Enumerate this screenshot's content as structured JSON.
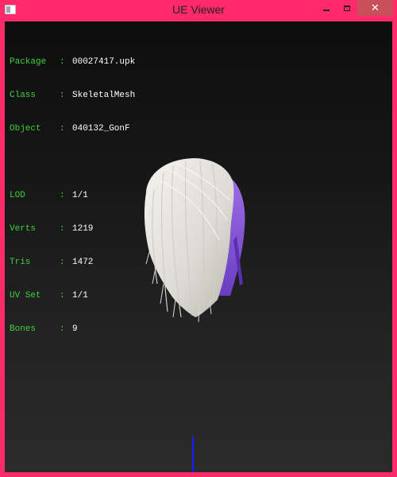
{
  "window": {
    "title": "UE Viewer",
    "minimize_label": "—",
    "close_label": "✕"
  },
  "info": {
    "top": [
      {
        "key": "Package",
        "sep": ":",
        "value": "00027417.upk"
      },
      {
        "key": "Class",
        "sep": ":",
        "value": "SkeletalMesh"
      },
      {
        "key": "Object",
        "sep": ":",
        "value": "040132_GonF"
      }
    ],
    "stats": [
      {
        "key": "LOD",
        "sep": ":",
        "value": "1/1"
      },
      {
        "key": "Verts",
        "sep": ":",
        "value": "1219"
      },
      {
        "key": "Tris",
        "sep": ":",
        "value": "1472"
      },
      {
        "key": "UV Set",
        "sep": ":",
        "value": "1/1"
      },
      {
        "key": "Bones",
        "sep": ":",
        "value": "9"
      }
    ]
  },
  "colors": {
    "frame": "#ff2a6a",
    "label": "#3cd23c",
    "value": "#ffffff",
    "axis": "#1a1aff",
    "hair_main": "#e8e6e0",
    "hair_accent": "#8a5ad8"
  }
}
